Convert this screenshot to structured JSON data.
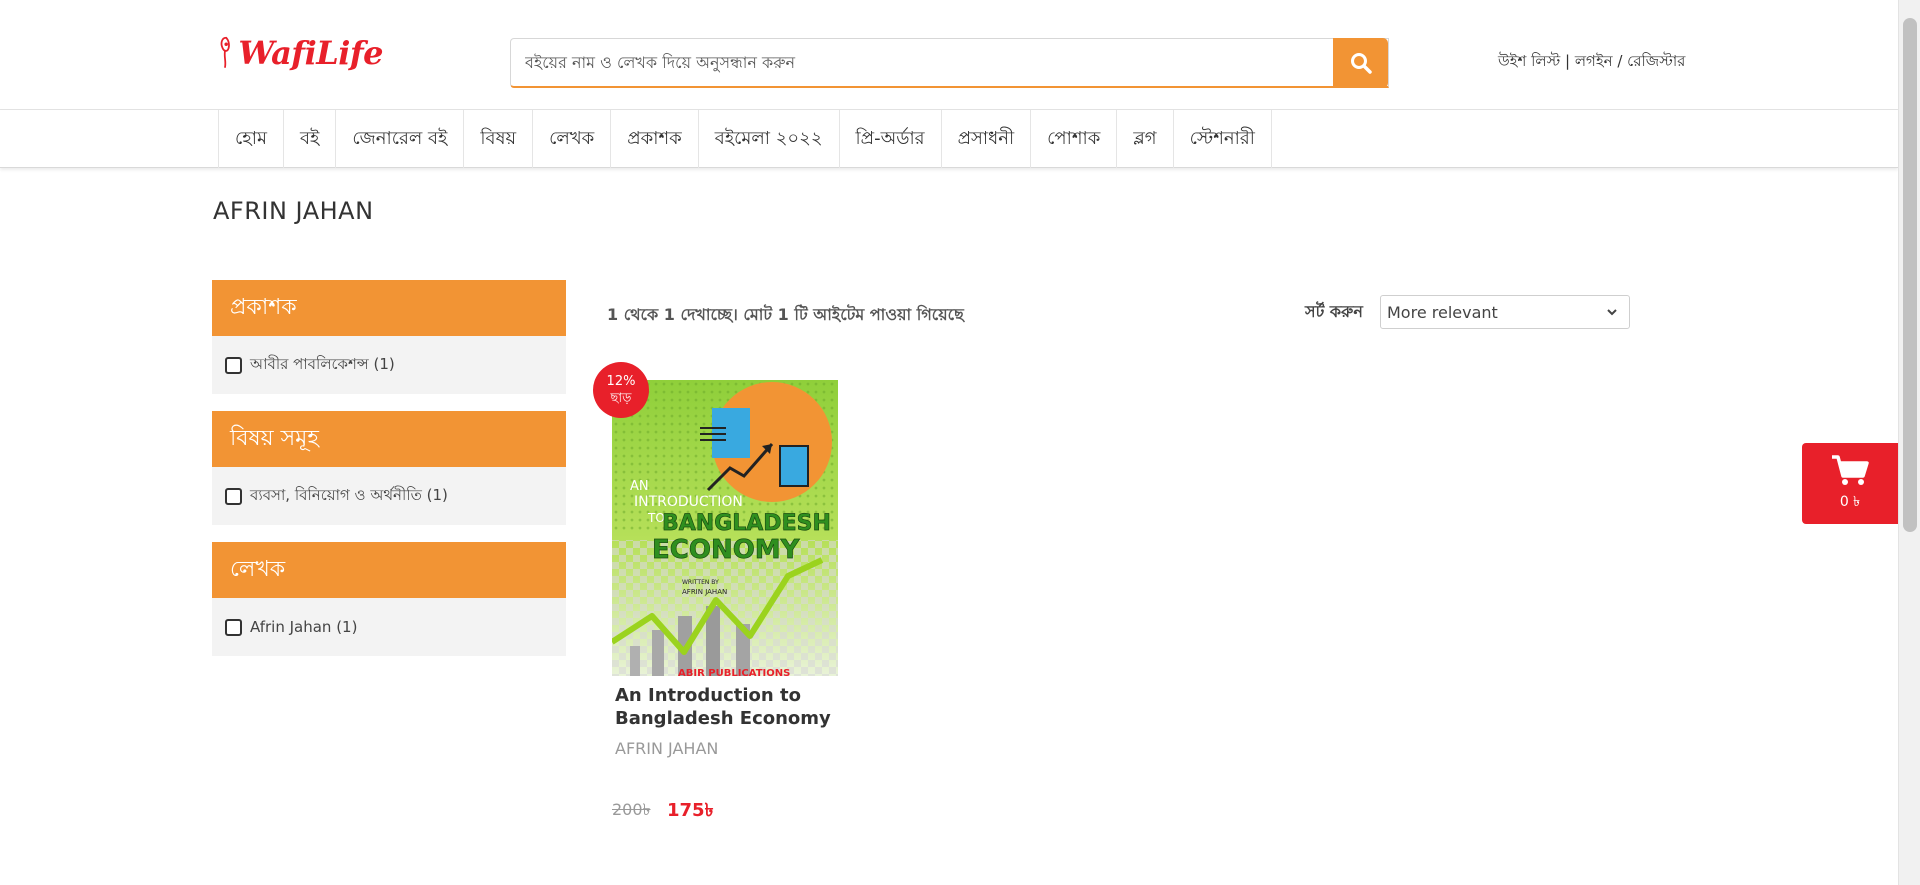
{
  "brand": {
    "logo_text": "WafiLife",
    "accent": "#f29434",
    "red": "#e8202a"
  },
  "search": {
    "placeholder": "বইয়ের নাম ও লেখক দিয়ে অনুসন্ধান করুন"
  },
  "top_links": {
    "wishlist": "উইশ লিস্ট",
    "separator1": " | ",
    "login": "লগইন",
    "separator2": " / ",
    "register": "রেজিস্টার"
  },
  "nav": [
    "হোম",
    "বই",
    "জেনারেল বই",
    "বিষয়",
    "লেখক",
    "প্রকাশক",
    "বইমেলা ২০২২",
    "প্রি-অর্ডার",
    "প্রসাধনী",
    "পোশাক",
    "ব্লগ",
    "স্টেশনারী"
  ],
  "page_title": "AFRIN JAHAN",
  "filters": {
    "publisher": {
      "title": "প্রকাশক",
      "option": "আবীর পাবলিকেশন্স (1)"
    },
    "subject": {
      "title": "বিষয় সমূহ",
      "option": "ব্যবসা, বিনিয়োগ ও অর্থনীতি (1)"
    },
    "author": {
      "title": "লেখক",
      "option": "Afrin Jahan (1)"
    }
  },
  "results": {
    "count_text": "1 থেকে 1 দেখাচ্ছে। মোট 1 টি আইটেম পাওয়া গিয়েছে",
    "sort_label": "সর্ট করুন",
    "sort_value": "More relevant"
  },
  "product": {
    "discount_percent": "12%",
    "discount_label": "ছাড়",
    "title": "An Introduction to Bangladesh Economy",
    "author": "AFRIN JAHAN",
    "old_price": "200৳",
    "new_price": "175৳",
    "cover": {
      "line1": "AN",
      "line2": "INTRODUCTION",
      "line3": "TO",
      "line4": "BANGLADESH",
      "line5": "ECONOMY",
      "written_by": "WRITTEN BY",
      "cover_author": "AFRIN JAHAN",
      "publisher": "ABIR PUBLICATIONS"
    }
  },
  "cart": {
    "count": "0 ৳"
  }
}
